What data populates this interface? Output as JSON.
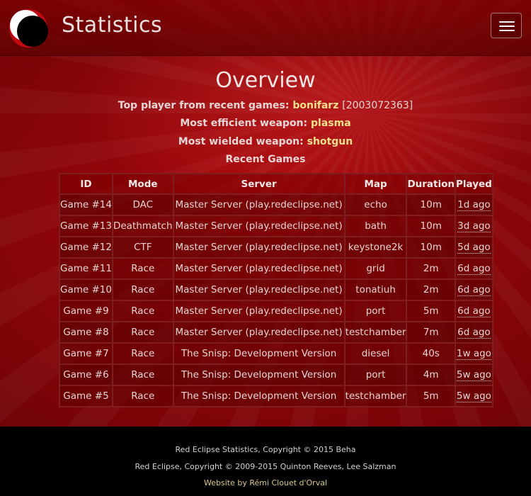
{
  "navbar": {
    "brand": "Statistics",
    "menu_toggle": "hamburger-menu-icon"
  },
  "overview": {
    "title": "Overview",
    "top_player_label": "Top player from recent games:",
    "top_player_name": "bonifarz",
    "top_player_id": "[2003072363]",
    "efficient_weapon_label": "Most efficient weapon:",
    "efficient_weapon": "plasma",
    "wielded_weapon_label": "Most wielded weapon:",
    "wielded_weapon": "shotgun",
    "recent_games_label": "Recent Games"
  },
  "table": {
    "headers": [
      "ID",
      "Mode",
      "Server",
      "Map",
      "Duration",
      "Played"
    ],
    "rows": [
      {
        "id": "Game #14",
        "mode": "DAC",
        "server": "Master Server (play.redeclipse.net)",
        "map": "echo",
        "duration": "10m",
        "played": "1d ago"
      },
      {
        "id": "Game #13",
        "mode": "Deathmatch",
        "server": "Master Server (play.redeclipse.net)",
        "map": "bath",
        "duration": "10m",
        "played": "3d ago"
      },
      {
        "id": "Game #12",
        "mode": "CTF",
        "server": "Master Server (play.redeclipse.net)",
        "map": "keystone2k",
        "duration": "10m",
        "played": "5d ago"
      },
      {
        "id": "Game #11",
        "mode": "Race",
        "server": "Master Server (play.redeclipse.net)",
        "map": "grid",
        "duration": "2m",
        "played": "6d ago"
      },
      {
        "id": "Game #10",
        "mode": "Race",
        "server": "Master Server (play.redeclipse.net)",
        "map": "tonatiuh",
        "duration": "2m",
        "played": "6d ago"
      },
      {
        "id": "Game #9",
        "mode": "Race",
        "server": "Master Server (play.redeclipse.net)",
        "map": "port",
        "duration": "5m",
        "played": "6d ago"
      },
      {
        "id": "Game #8",
        "mode": "Race",
        "server": "Master Server (play.redeclipse.net)",
        "map": "testchamber",
        "duration": "7m",
        "played": "6d ago"
      },
      {
        "id": "Game #7",
        "mode": "Race",
        "server": "The Snisp: Development Version",
        "map": "diesel",
        "duration": "40s",
        "played": "1w ago"
      },
      {
        "id": "Game #6",
        "mode": "Race",
        "server": "The Snisp: Development Version",
        "map": "port",
        "duration": "4m",
        "played": "5w ago"
      },
      {
        "id": "Game #5",
        "mode": "Race",
        "server": "The Snisp: Development Version",
        "map": "testchamber",
        "duration": "5m",
        "played": "5w ago"
      }
    ]
  },
  "footer": {
    "line1": "Red Eclipse Statistics, Copyright © 2015 Beha",
    "line2": "Red Eclipse, Copyright © 2009-2015 Quinton Reeves, Lee Salzman",
    "line3": "Website by Rémi Clouet d'Orval"
  },
  "colors": {
    "background": "#8a0508",
    "highlight": "#f2e08a",
    "table_border": "#7e1e1e",
    "footer_bg": "#000000"
  }
}
